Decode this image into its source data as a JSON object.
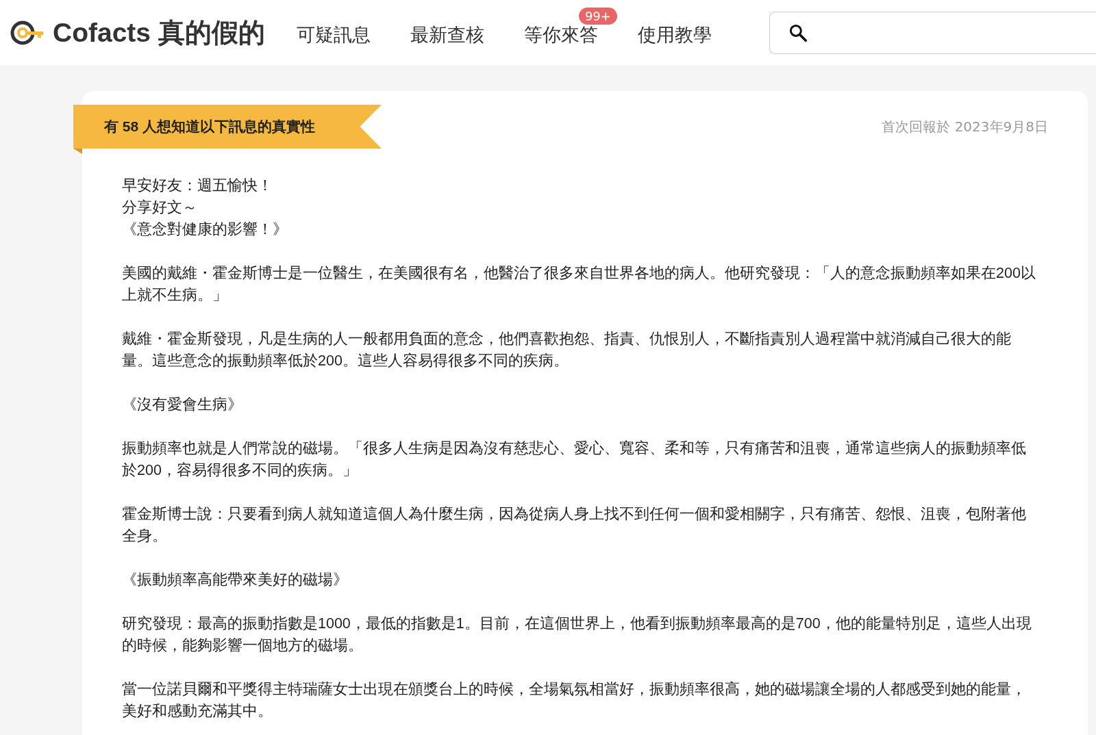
{
  "header": {
    "logo": "Cofacts 真的假的",
    "nav": [
      {
        "label": "可疑訊息"
      },
      {
        "label": "最新查核"
      },
      {
        "label": "等你來答",
        "badge": "99+"
      },
      {
        "label": "使用教學"
      }
    ]
  },
  "article": {
    "ribbon": "有 58 人想知道以下訊息的真實性",
    "first_reported": "首次回報於 2023年9月8日",
    "intro_lines": [
      "早安好友：週五愉快！",
      "分享好文～",
      "《意念對健康的影響！》"
    ],
    "paragraphs": [
      "美國的戴維・霍金斯博士是一位醫生，在美國很有名，他醫治了很多來自世界各地的病人。他研究發現：「人的意念振動頻率如果在200以上就不生病。」",
      "戴維・霍金斯發現，凡是生病的人一般都用負面的意念，他們喜歡抱怨、指責、仇恨別人，不斷指責別人過程當中就消減自己很大的能量。這些意念的振動頻率低於200。這些人容易得很多不同的疾病。",
      "《沒有愛會生病》",
      "振動頻率也就是人們常說的磁場。「很多人生病是因為沒有慈悲心、愛心、寬容、柔和等，只有痛苦和沮喪，通常這些病人的振動頻率低於200，容易得很多不同的疾病。」",
      "霍金斯博士說：只要看到病人就知道這個人為什麼生病，因為從病人身上找不到任何一個和愛相關字，只有痛苦、怨恨、沮喪，包附著他全身。",
      "《振動頻率高能帶來美好的磁場》",
      "研究發現：最高的振動指數是1000，最低的指數是1。目前，在這個世界上，他看到振動頻率最高的是700，他的能量特別足，這些人出現的時候，能夠影響一個地方的磁場。",
      "當一位諾貝爾和平獎得主特瑞薩女士出現在頒獎台上的時候，全場氣氛相當好，振動頻率很高，她的磁場讓全場的人都感受到她的能量，美好和感動充滿其中。"
    ]
  }
}
